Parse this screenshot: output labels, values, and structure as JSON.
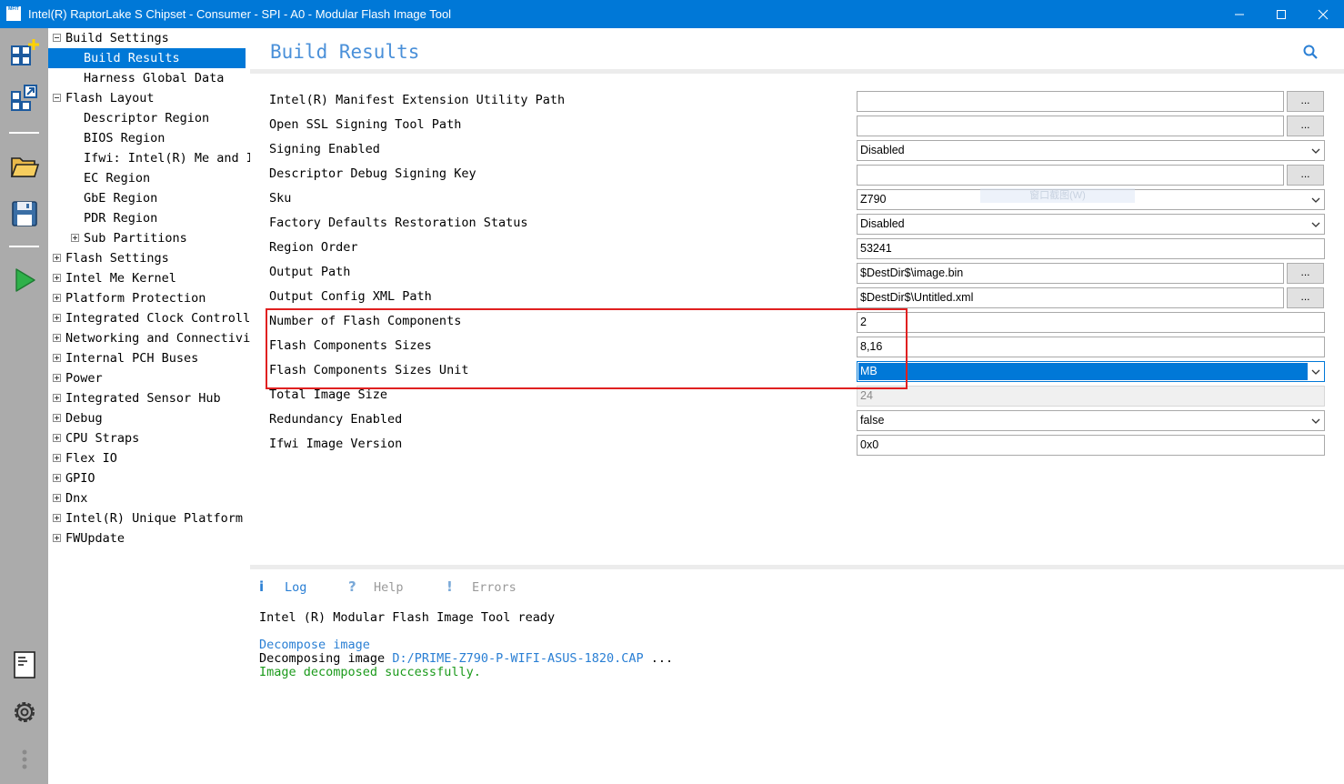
{
  "window": {
    "icon_label": "MFIT",
    "title": "Intel(R) RaptorLake S Chipset - Consumer - SPI - A0  -  Modular Flash Image Tool"
  },
  "toolstrip": {
    "icons": [
      "new-project-icon",
      "import-icon",
      "open-folder-icon",
      "save-icon",
      "build-icon",
      "log-document-icon",
      "settings-gear-icon",
      "more-icon"
    ]
  },
  "tree": {
    "items": [
      {
        "label": "Build Settings",
        "level": 0,
        "expander": "minus"
      },
      {
        "label": "Build Results",
        "level": 1,
        "selected": true
      },
      {
        "label": "Harness Global Data",
        "level": 1
      },
      {
        "label": "Flash Layout",
        "level": 0,
        "expander": "minus"
      },
      {
        "label": "Descriptor Region",
        "level": 1
      },
      {
        "label": "BIOS Region",
        "level": 1
      },
      {
        "label": "Ifwi: Intel(R) Me and I",
        "level": 1
      },
      {
        "label": "EC Region",
        "level": 1
      },
      {
        "label": "GbE Region",
        "level": 1
      },
      {
        "label": "PDR Region",
        "level": 1
      },
      {
        "label": "Sub Partitions",
        "level": 1,
        "expander": "plus"
      },
      {
        "label": "Flash Settings",
        "level": 0,
        "expander": "plus"
      },
      {
        "label": "Intel Me Kernel",
        "level": 0,
        "expander": "plus"
      },
      {
        "label": "Platform Protection",
        "level": 0,
        "expander": "plus"
      },
      {
        "label": "Integrated Clock Controll",
        "level": 0,
        "expander": "plus"
      },
      {
        "label": "Networking and Connectivi",
        "level": 0,
        "expander": "plus"
      },
      {
        "label": "Internal PCH Buses",
        "level": 0,
        "expander": "plus"
      },
      {
        "label": "Power",
        "level": 0,
        "expander": "plus"
      },
      {
        "label": "Integrated Sensor Hub",
        "level": 0,
        "expander": "plus"
      },
      {
        "label": "Debug",
        "level": 0,
        "expander": "plus"
      },
      {
        "label": "CPU Straps",
        "level": 0,
        "expander": "plus"
      },
      {
        "label": "Flex IO",
        "level": 0,
        "expander": "plus"
      },
      {
        "label": "GPIO",
        "level": 0,
        "expander": "plus"
      },
      {
        "label": "Dnx",
        "level": 0,
        "expander": "plus"
      },
      {
        "label": "Intel(R) Unique Platform",
        "level": 0,
        "expander": "plus"
      },
      {
        "label": "FWUpdate",
        "level": 0,
        "expander": "plus"
      }
    ]
  },
  "main": {
    "title": "Build Results",
    "browse_label": "...",
    "ghost_text": "窗口截图(W)",
    "properties": [
      {
        "label": "Intel(R) Manifest Extension Utility Path",
        "value": "",
        "kind": "browse"
      },
      {
        "label": "Open SSL Signing Tool Path",
        "value": "",
        "kind": "browse"
      },
      {
        "label": "Signing Enabled",
        "value": "Disabled",
        "kind": "dropdown"
      },
      {
        "label": "Descriptor Debug Signing Key",
        "value": "",
        "kind": "browse"
      },
      {
        "label": "Sku",
        "value": "Z790",
        "kind": "dropdown"
      },
      {
        "label": "Factory Defaults Restoration Status",
        "value": "Disabled",
        "kind": "dropdown"
      },
      {
        "label": "Region Order",
        "value": "53241",
        "kind": "text"
      },
      {
        "label": "Output Path",
        "value": "$DestDir$\\image.bin",
        "kind": "browse"
      },
      {
        "label": "Output Config XML Path",
        "value": "$DestDir$\\Untitled.xml",
        "kind": "browse"
      },
      {
        "label": "Number of Flash Components",
        "value": "2",
        "kind": "text"
      },
      {
        "label": "Flash Components Sizes",
        "value": "8,16",
        "kind": "text"
      },
      {
        "label": "Flash Components Sizes Unit",
        "value": "MB",
        "kind": "dropdown",
        "selected": true
      },
      {
        "label": "Total Image Size",
        "value": "24",
        "kind": "disabled"
      },
      {
        "label": "Redundancy Enabled",
        "value": "false",
        "kind": "dropdown"
      },
      {
        "label": "Ifwi Image Version",
        "value": "0x0",
        "kind": "text"
      }
    ]
  },
  "log": {
    "tabs": [
      {
        "icon": "i",
        "label": "Log",
        "active": true
      },
      {
        "icon": "?",
        "label": "Help",
        "active": false
      },
      {
        "icon": "!",
        "label": "Errors",
        "active": false
      }
    ],
    "ready_line": "Intel (R) Modular Flash Image Tool ready",
    "decompose_heading": "Decompose image",
    "decomposing_prefix": "Decomposing image ",
    "decomposing_path": "D:/PRIME-Z790-P-WIFI-ASUS-1820.CAP",
    "decomposing_suffix": " ...",
    "success_line": "Image decomposed successfully."
  },
  "colors": {
    "accent": "#0078d7",
    "title_blue": "#4a90d9",
    "highlight_red": "#e02020",
    "success_green": "#1b9a1b",
    "link_blue": "#2a7fd4",
    "build_green": "#2fb14a"
  }
}
